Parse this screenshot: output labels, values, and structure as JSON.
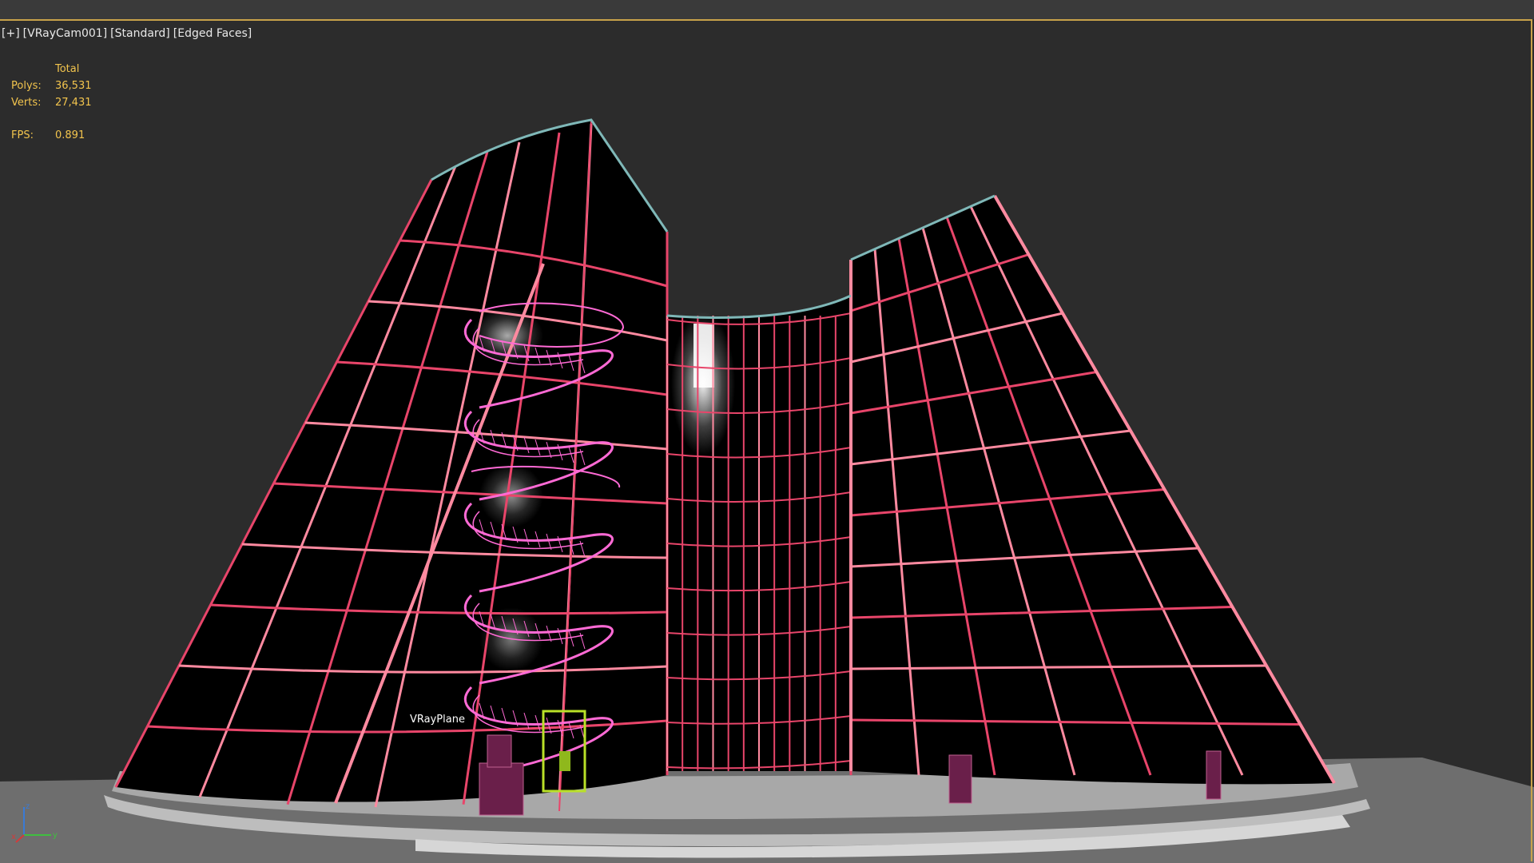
{
  "viewport": {
    "label_plus": "[+]",
    "label_camera": "[VRayCam001]",
    "label_shading": "[Standard]",
    "label_edges": "[Edged Faces]"
  },
  "stats": {
    "header": "Total",
    "polys_label": "Polys:",
    "polys_value": "36,531",
    "verts_label": "Verts:",
    "verts_value": "27,431",
    "fps_label": "FPS:",
    "fps_value": "0.891"
  },
  "scene": {
    "object_label": "VRayPlane",
    "axis_z": "z",
    "axis_x": "x",
    "axis_y": "y"
  },
  "colors": {
    "viewport_bg": "#2c2c2c",
    "active_border": "#c8a24a",
    "stats_text": "#f2c44d",
    "wire_frame": "#e8456a",
    "wire_highlight": "#ff8aa0",
    "stair_wire": "#ff6ad5",
    "selection": "#b9e027",
    "ground": "#7c7c7c"
  }
}
